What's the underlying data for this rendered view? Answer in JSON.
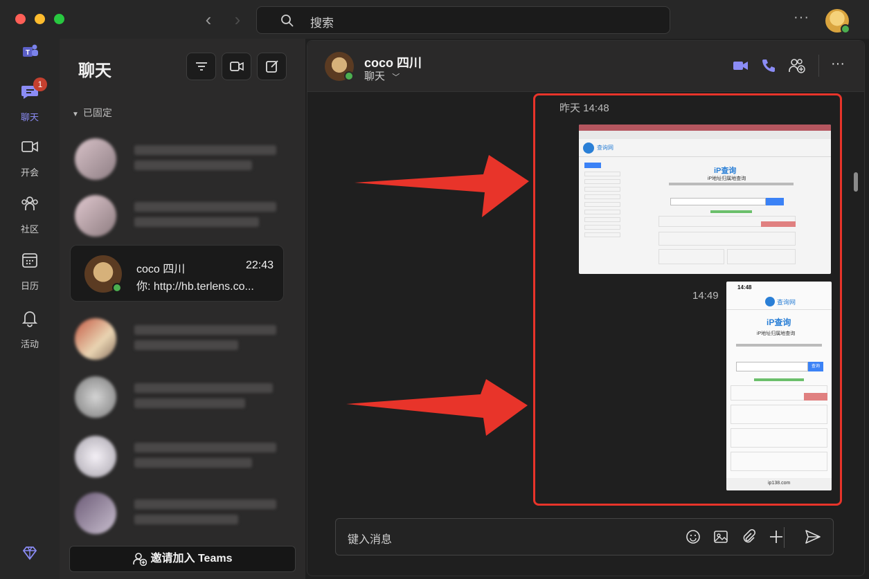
{
  "search": {
    "placeholder": "搜索"
  },
  "rail": {
    "items": [
      {
        "label": "聊天",
        "badge": "1"
      },
      {
        "label": "开会"
      },
      {
        "label": "社区"
      },
      {
        "label": "日历"
      },
      {
        "label": "活动"
      }
    ]
  },
  "chat_list": {
    "title": "聊天",
    "pinned_label": "已固定",
    "active": {
      "name": "coco 四川",
      "time": "22:43",
      "preview": "你: http://hb.terlens.co..."
    },
    "invite_label": "邀请加入 Teams"
  },
  "chat": {
    "contact_name": "coco 四川",
    "subtitle": "聊天",
    "messages": [
      {
        "time": "昨天 14:48",
        "type": "image",
        "description": "desktop screenshot"
      },
      {
        "time": "14:49",
        "type": "image",
        "description": "mobile screenshot"
      }
    ],
    "composer_placeholder": "键入消息"
  },
  "shot1": {
    "heading": "iP查询",
    "subheading": "iP地址归属地查询",
    "site": "查询网"
  },
  "shot2": {
    "status_time": "14:48",
    "site": "查询网",
    "heading": "iP查询",
    "subheading": "iP地址归属地查询",
    "query_btn": "查询",
    "url": "ip138.com"
  },
  "colors": {
    "accent": "#8b8cf5",
    "highlight_red": "#e8342a",
    "badge": "#c4402f"
  }
}
